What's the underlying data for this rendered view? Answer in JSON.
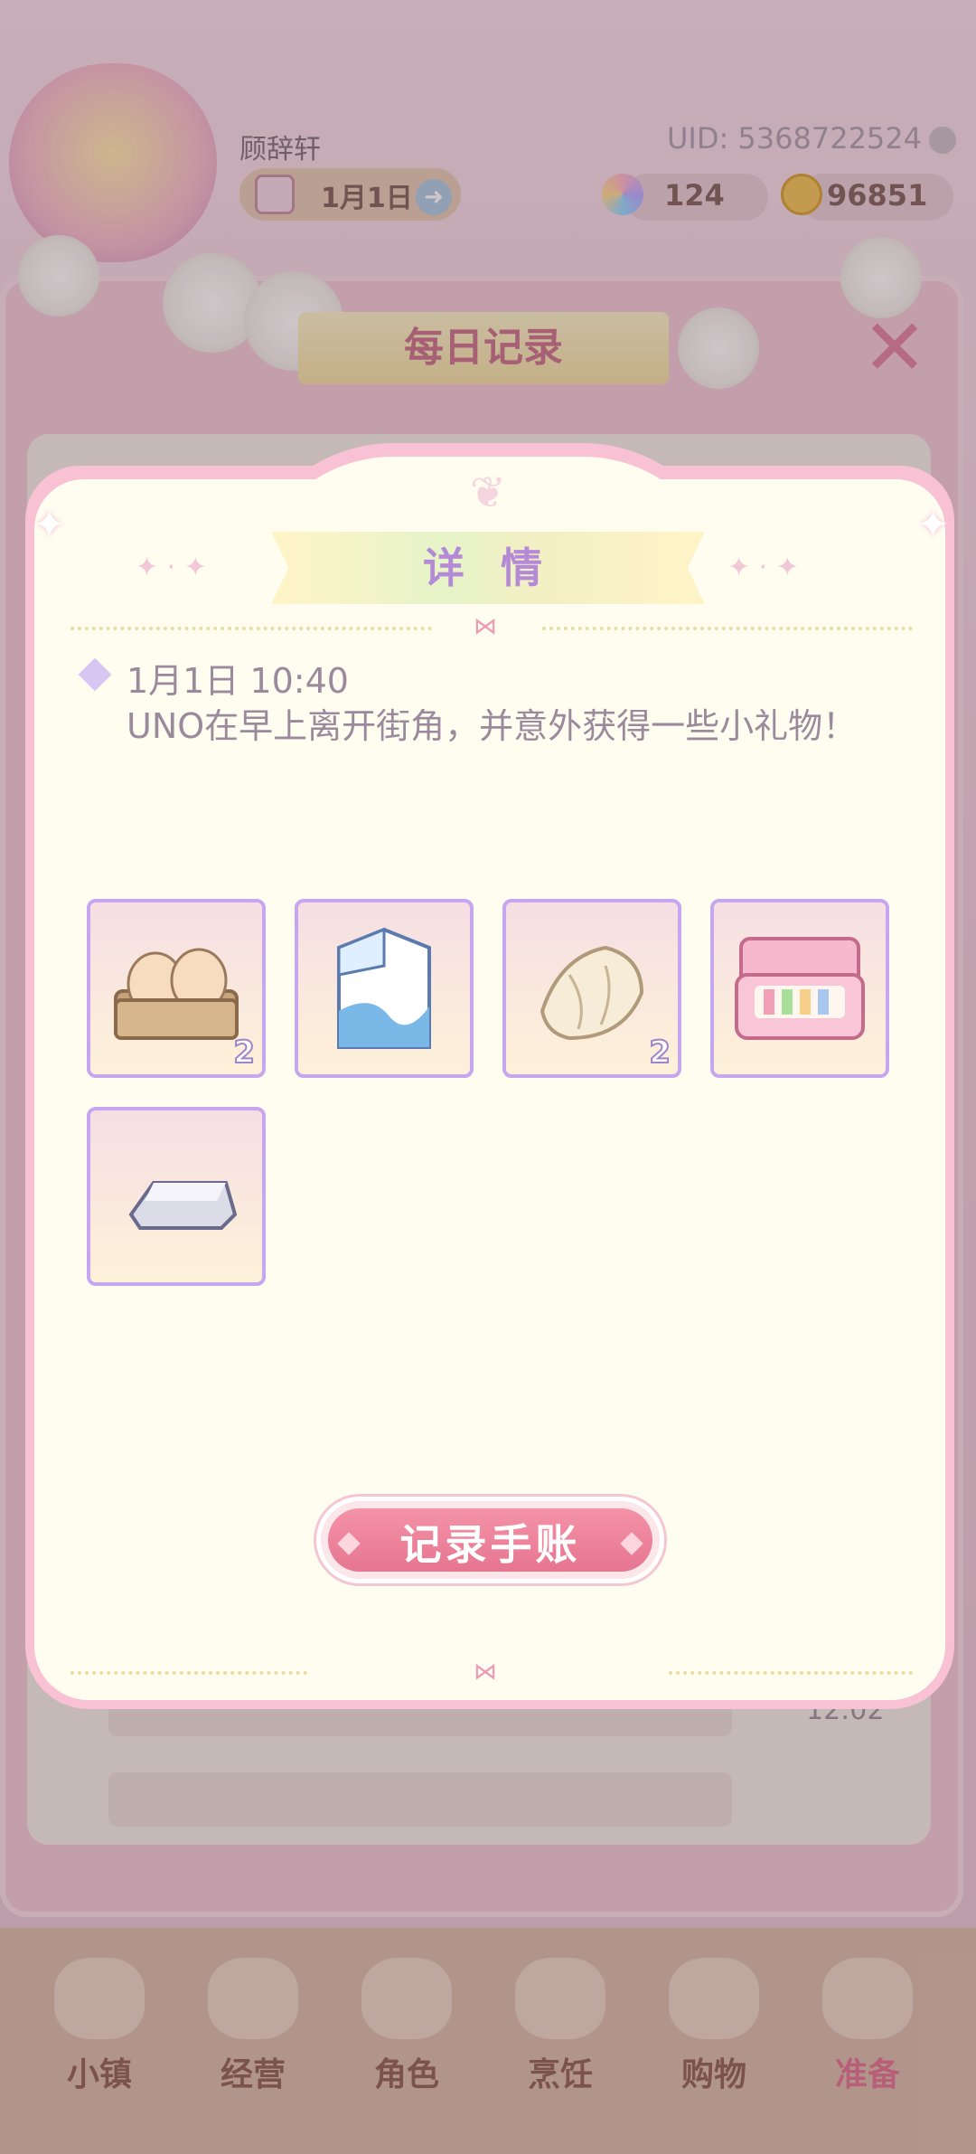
{
  "player": {
    "name": "顾辞轩",
    "uid": "UID: 5368722524",
    "date": "1月1日",
    "gems": "124",
    "coins": "96851"
  },
  "daily_panel": {
    "title": "每日记录",
    "visible_time": "12:02"
  },
  "details_modal": {
    "title": "详 情",
    "entry_time": "1月1日 10:40",
    "entry_message": "UNO在早上离开街角，并意外获得一些小礼物！",
    "items": [
      {
        "icon": "egg-carton-icon",
        "quantity": "2"
      },
      {
        "icon": "milk-carton-icon",
        "quantity": ""
      },
      {
        "icon": "cotton-fabric-icon",
        "quantity": "2"
      },
      {
        "icon": "makeup-box-icon",
        "quantity": ""
      },
      {
        "icon": "silver-ingot-icon",
        "quantity": ""
      }
    ],
    "action_button": "记录手账"
  },
  "bottom_nav": [
    {
      "label": "小镇",
      "icon": "map-icon",
      "active": false
    },
    {
      "label": "经营",
      "icon": "top-hat-icon",
      "active": false
    },
    {
      "label": "角色",
      "icon": "character-icon",
      "active": false
    },
    {
      "label": "烹饪",
      "icon": "sandwich-icon",
      "active": false
    },
    {
      "label": "购物",
      "icon": "shopping-bag-icon",
      "active": false
    },
    {
      "label": "准备",
      "icon": "basket-icon",
      "active": true
    }
  ],
  "colors": {
    "accent_pink": "#e67590",
    "title_purple": "#b48ad6",
    "modal_bg": "#fefdf0",
    "item_border": "#c6a6ee"
  }
}
